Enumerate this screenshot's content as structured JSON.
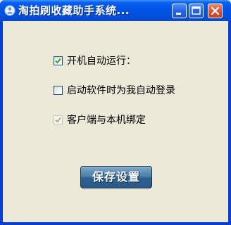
{
  "window": {
    "title": "淘拍刷收藏助手系统..."
  },
  "options": [
    {
      "label": "开机自动运行：",
      "checked": true,
      "disabled": false
    },
    {
      "label": "启动软件时为我自动登录",
      "checked": false,
      "disabled": false
    },
    {
      "label": "客户端与本机绑定",
      "checked": true,
      "disabled": true
    }
  ],
  "buttons": {
    "save_label": "保存设置"
  },
  "colors": {
    "titlebar": "#0055e5",
    "client_bg": "#ece9d8",
    "save_button": "#3a6a96",
    "close_button": "#d9573a"
  }
}
